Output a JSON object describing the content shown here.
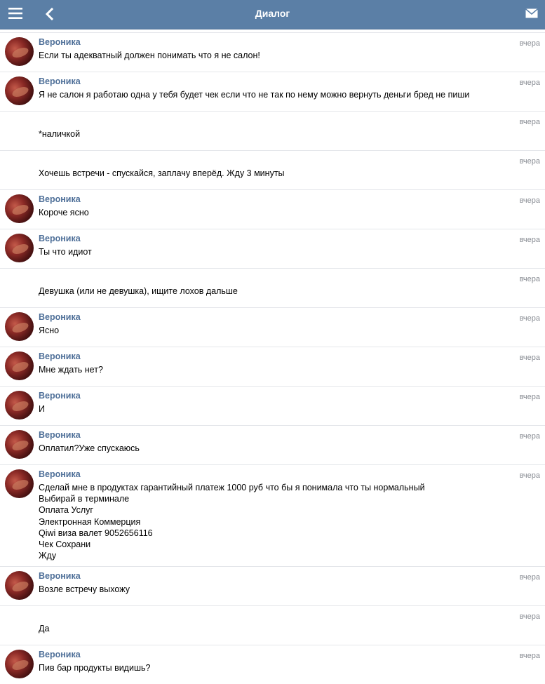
{
  "header": {
    "title": "Диалог",
    "menu_icon": "hamburger-menu-icon",
    "back_icon": "chevron-left-icon",
    "mail_icon": "envelope-icon",
    "background_color": "#5b7fa6"
  },
  "messages": [
    {
      "sender": "Вероника",
      "text": "Если ты адекватный должен понимать что я не салон!",
      "time": "вчера",
      "has_avatar": true
    },
    {
      "sender": "Вероника",
      "text": "Я не салон я работаю одна у тебя будет чек если что не так по нему можно вернуть деньги бред не пиши",
      "time": "вчера",
      "has_avatar": true
    },
    {
      "sender": "",
      "text": "*наличкой",
      "time": "вчера",
      "has_avatar": false
    },
    {
      "sender": "",
      "text": "Хочешь встречи - спускайся, заплачу вперёд. Жду 3 минуты",
      "time": "вчера",
      "has_avatar": false
    },
    {
      "sender": "Вероника",
      "text": "Короче ясно",
      "time": "вчера",
      "has_avatar": true
    },
    {
      "sender": "Вероника",
      "text": "Ты что идиот",
      "time": "вчера",
      "has_avatar": true
    },
    {
      "sender": "",
      "text": "Девушка (или не девушка), ищите лохов дальше",
      "time": "вчера",
      "has_avatar": false
    },
    {
      "sender": "Вероника",
      "text": "Ясно",
      "time": "вчера",
      "has_avatar": true
    },
    {
      "sender": "Вероника",
      "text": "Мне ждать нет?",
      "time": "вчера",
      "has_avatar": true
    },
    {
      "sender": "Вероника",
      "text": "И",
      "time": "вчера",
      "has_avatar": true
    },
    {
      "sender": "Вероника",
      "text": "Оплатил?Уже спускаюсь",
      "time": "вчера",
      "has_avatar": true
    },
    {
      "sender": "Вероника",
      "text": "Сделай мне в продуктах гарантийный платеж 1000 руб что бы я понимала что ты нормальный\nВыбирай в терминале\nОплата Услуг\nЭлектронная Коммерция\nQiwi виза валет 9052656116\nЧек Сохрани\nЖду",
      "time": "вчера",
      "has_avatar": true
    },
    {
      "sender": "Вероника",
      "text": "Возле встречу выхожу",
      "time": "вчера",
      "has_avatar": true
    },
    {
      "sender": "",
      "text": "Да",
      "time": "вчера",
      "has_avatar": false
    },
    {
      "sender": "Вероника",
      "text": "Пив бар продукты видишь?",
      "time": "вчера",
      "has_avatar": true
    }
  ]
}
